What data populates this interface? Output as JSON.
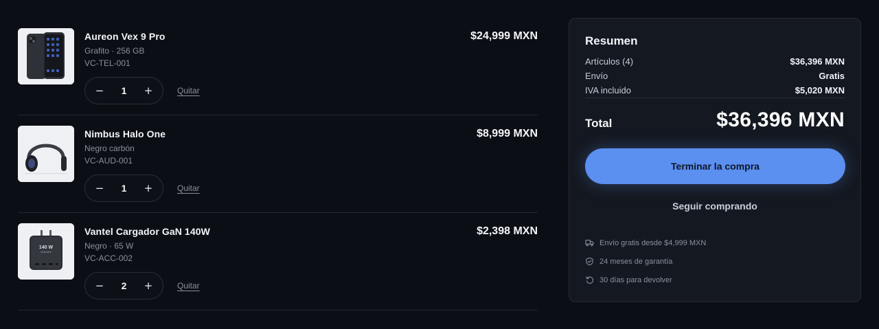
{
  "cart": {
    "items": [
      {
        "name": "Aureon Vex 9 Pro",
        "variant": "Grafito · 256 GB",
        "sku": "VC-TEL-001",
        "price": "$24,999 MXN",
        "qty": "1",
        "remove_label": "Quitar",
        "decrease": "−",
        "increase": "+",
        "thumb_icon": "phone-image"
      },
      {
        "name": "Nimbus Halo One",
        "variant": "Negro carbón",
        "sku": "VC-AUD-001",
        "price": "$8,999 MXN",
        "qty": "1",
        "remove_label": "Quitar",
        "decrease": "−",
        "increase": "+",
        "thumb_icon": "headphones-image"
      },
      {
        "name": "Vantel Cargador GaN 140W",
        "variant": "Negro · 65 W",
        "sku": "VC-ACC-002",
        "price": "$2,398 MXN",
        "qty": "2",
        "remove_label": "Quitar",
        "decrease": "−",
        "increase": "+",
        "thumb_icon": "charger-image",
        "thumb_text": "140 W"
      }
    ]
  },
  "summary": {
    "title": "Resumen",
    "rows": [
      {
        "label": "Artículos (4)",
        "value": "$36,396 MXN"
      },
      {
        "label": "Envío",
        "value": "Gratis"
      },
      {
        "label": "IVA incluido",
        "value": "$5,020 MXN"
      }
    ],
    "total_label": "Total",
    "total_value": "$36,396 MXN",
    "checkout_label": "Terminar la compra",
    "continue_label": "Seguir comprando",
    "perks": [
      {
        "icon": "truck-icon",
        "text": "Envío gratis desde $4,999 MXN"
      },
      {
        "icon": "shield-icon",
        "text": "24 meses de garantía"
      },
      {
        "icon": "return-icon",
        "text": "30 días para devolver"
      }
    ]
  },
  "colors": {
    "background": "#0b0e14",
    "card": "#141820",
    "accent": "#5b8ff0",
    "muted_text": "#8a909c"
  }
}
